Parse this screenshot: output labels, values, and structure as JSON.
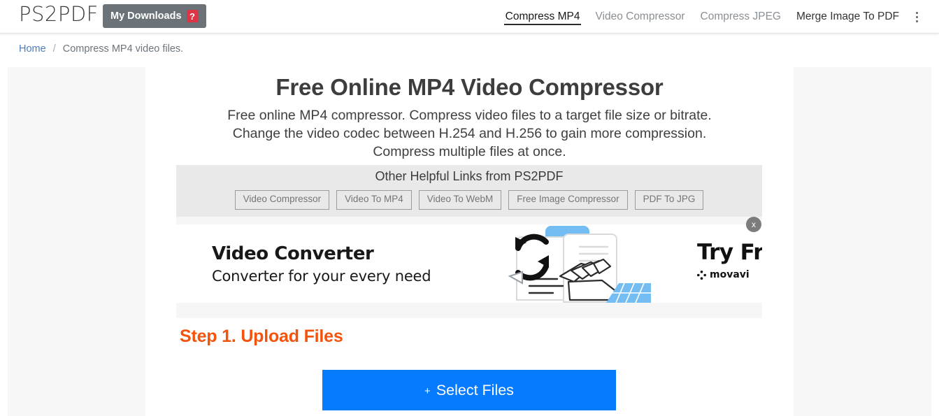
{
  "header": {
    "logo": "PS2PDF",
    "downloads_button": {
      "label": "My Downloads",
      "badge": "?"
    },
    "nav": [
      {
        "label": "Compress MP4",
        "state": "active"
      },
      {
        "label": "Video Compressor",
        "state": "muted"
      },
      {
        "label": "Compress JPEG",
        "state": "muted"
      },
      {
        "label": "Merge Image To PDF",
        "state": "strong"
      }
    ],
    "menu_icon": "kebab-menu-icon"
  },
  "breadcrumb": {
    "home": "Home",
    "separator": "/",
    "current": "Compress MP4 video files."
  },
  "main": {
    "title": "Free Online MP4 Video Compressor",
    "description_line1": "Free online MP4 compressor. Compress video files to a target file size or bitrate.",
    "description_line2": "Change the video codec between H.254 and H.256 to gain more compression.",
    "description_line3": "Compress multiple files at once.",
    "helpful_links": {
      "title": "Other Helpful Links from PS2PDF",
      "items": [
        "Video Compressor",
        "Video To MP4",
        "Video To WebM",
        "Free Image Compressor",
        "PDF To JPG"
      ]
    },
    "ad": {
      "headline": "Video Converter",
      "subhead": "Converter for your every need",
      "cta": "Try Free",
      "brand": "movavi",
      "close_label": "x"
    },
    "step": {
      "title": "Step 1. Upload Files",
      "select_files_button": "Select Files",
      "select_files_plus": "+"
    }
  },
  "colors": {
    "accent_blue": "#067bfd",
    "accent_orange": "#f4530c",
    "badge_red": "#dc3545",
    "button_gray": "#6b7378",
    "link_blue": "#4a7ebb"
  }
}
